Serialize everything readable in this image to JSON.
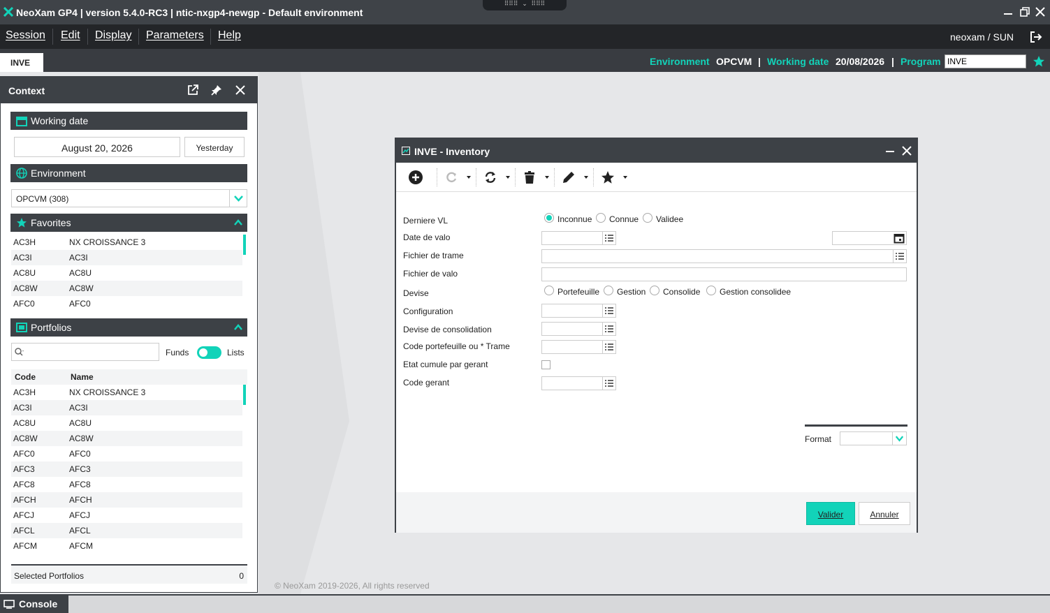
{
  "window": {
    "title": "NeoXam GP4 | version 5.4.0-RC3 | ntic-nxgp4-newgp - Default environment"
  },
  "menu": {
    "items": [
      "Session",
      "Edit",
      "Display",
      "Parameters",
      "Help"
    ],
    "user": "neoxam / SUN"
  },
  "tabs": [
    {
      "label": "INVE",
      "active": true
    }
  ],
  "status": {
    "env_label": "Environment",
    "env_value": "OPCVM",
    "date_label": "Working date",
    "date_value": "20/08/2026",
    "program_label": "Program",
    "program_value": "INVE",
    "sep": "|"
  },
  "context": {
    "title": "Context",
    "working_date_label": "Working date",
    "working_date_value": "August 20, 2026",
    "yesterday_label": "Yesterday",
    "environment_label": "Environment",
    "environment_value": "OPCVM (308)",
    "favorites_label": "Favorites",
    "favorites": [
      {
        "code": "AC3H",
        "name": "NX CROISSANCE 3"
      },
      {
        "code": "AC3I",
        "name": "AC3I"
      },
      {
        "code": "AC8U",
        "name": "AC8U"
      },
      {
        "code": "AC8W",
        "name": "AC8W"
      },
      {
        "code": "AFC0",
        "name": "AFC0"
      }
    ],
    "portfolios_label": "Portfolios",
    "funds_label": "Funds",
    "lists_label": "Lists",
    "col_code": "Code",
    "col_name": "Name",
    "portfolios": [
      {
        "code": "AC3H",
        "name": "NX CROISSANCE 3"
      },
      {
        "code": "AC3I",
        "name": "AC3I"
      },
      {
        "code": "AC8U",
        "name": "AC8U"
      },
      {
        "code": "AC8W",
        "name": "AC8W"
      },
      {
        "code": "AFC0",
        "name": "AFC0"
      },
      {
        "code": "AFC3",
        "name": "AFC3"
      },
      {
        "code": "AFC8",
        "name": "AFC8"
      },
      {
        "code": "AFCH",
        "name": "AFCH"
      },
      {
        "code": "AFCJ",
        "name": "AFCJ"
      },
      {
        "code": "AFCL",
        "name": "AFCL"
      },
      {
        "code": "AFCM",
        "name": "AFCM"
      }
    ],
    "selected_label": "Selected Portfolios",
    "selected_count": "0"
  },
  "copyright": "© NeoXam 2019-2026, All rights reserved",
  "console_label": "Console",
  "dialog": {
    "title": "INVE - Inventory",
    "fields": {
      "derniere_vl": "Derniere VL",
      "date_valo": "Date de valo",
      "fichier_trame": "Fichier de trame",
      "fichier_valo": "Fichier de valo",
      "devise": "Devise",
      "configuration": "Configuration",
      "devise_conso": "Devise de consolidation",
      "code_ptf": "Code portefeuille ou  * Trame",
      "etat_cumule": "Etat cumule par gerant",
      "code_gerant": "Code gerant",
      "format": "Format"
    },
    "vl_options": [
      "Inconnue",
      "Connue",
      "Validee"
    ],
    "vl_selected": "Inconnue",
    "devise_options": [
      "Portefeuille",
      "Gestion",
      "Consolide",
      "Gestion consolidee"
    ],
    "valider": "Valider",
    "annuler": "Annuler"
  },
  "colors": {
    "accent": "#12d3b9",
    "dark": "#3d4146"
  }
}
